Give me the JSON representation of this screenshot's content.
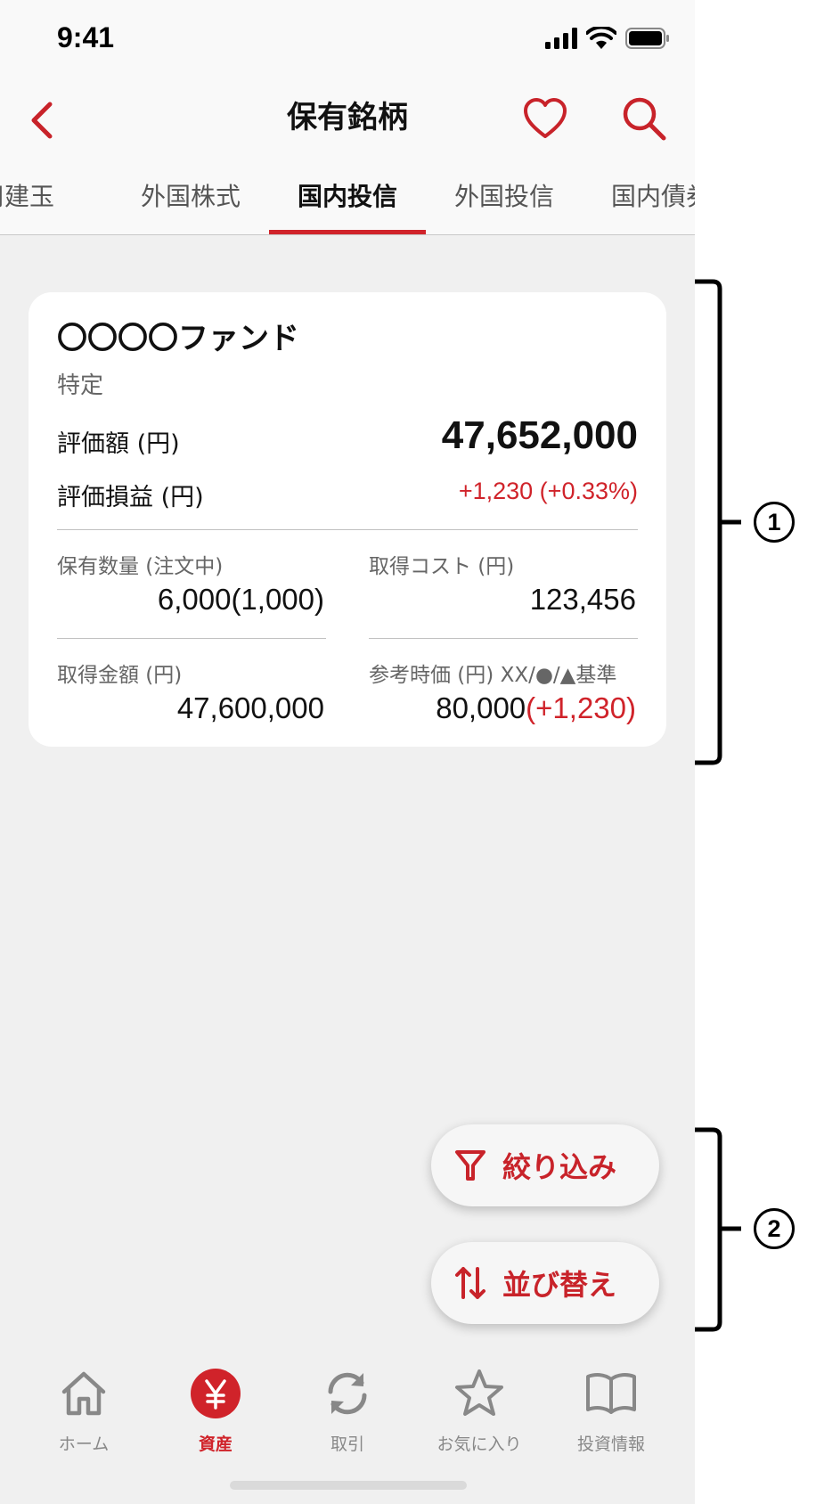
{
  "status_bar": {
    "time": "9:41"
  },
  "header": {
    "title": "保有銘柄"
  },
  "tabs": [
    {
      "label": "信用建玉",
      "active": false
    },
    {
      "label": "外国株式",
      "active": false
    },
    {
      "label": "国内投信",
      "active": true
    },
    {
      "label": "外国投信",
      "active": false
    },
    {
      "label": "国内債券",
      "active": false
    }
  ],
  "holding": {
    "name": "〇〇〇〇ファンド",
    "account_type": "特定",
    "valuation_label": "評価額 (円)",
    "valuation_value": "47,652,000",
    "pl_label": "評価損益 (円)",
    "pl_value": "+1,230 (+0.33%)",
    "quantity_label": "保有数量 (注文中)",
    "quantity_value": "6,000",
    "quantity_pending": "(1,000)",
    "cost_label": "取得コスト (円)",
    "cost_value": "123,456",
    "amount_label": "取得金額 (円)",
    "amount_value": "47,600,000",
    "ref_price_label": "参考時価 (円) XX/●/▲基準",
    "ref_price_value": "80,000",
    "ref_price_change": "(+1,230)"
  },
  "actions": {
    "filter_label": "絞り込み",
    "sort_label": "並び替え"
  },
  "bottom_nav": [
    {
      "label": "ホーム",
      "icon": "home-icon",
      "active": false
    },
    {
      "label": "資産",
      "icon": "yen-icon",
      "active": true
    },
    {
      "label": "取引",
      "icon": "refresh-icon",
      "active": false
    },
    {
      "label": "お気に入り",
      "icon": "star-icon",
      "active": false
    },
    {
      "label": "投資情報",
      "icon": "book-icon",
      "active": false
    }
  ],
  "annotations": {
    "marker_1": "1",
    "marker_2": "2"
  },
  "colors": {
    "accent": "#d0232a",
    "background": "#f0f0f0",
    "card": "#ffffff"
  }
}
